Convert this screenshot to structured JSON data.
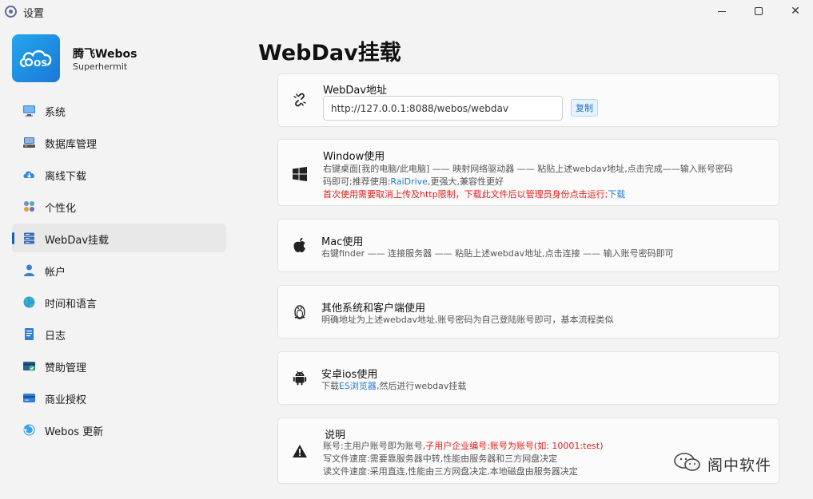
{
  "window": {
    "title": "设置",
    "minimize_glyph": "",
    "maximize_glyph": "",
    "close_glyph": "✕"
  },
  "profile": {
    "name": "腾飞Webos",
    "subtitle": "Superhermit",
    "logo_text": "OS"
  },
  "sidebar": {
    "items": [
      {
        "label": "系统",
        "icon": "monitor-icon"
      },
      {
        "label": "数据库管理",
        "icon": "database-icon"
      },
      {
        "label": "离线下载",
        "icon": "cloud-download-icon"
      },
      {
        "label": "个性化",
        "icon": "personalize-icon"
      },
      {
        "label": "WebDav挂载",
        "icon": "server-icon",
        "active": true
      },
      {
        "label": "帐户",
        "icon": "account-icon"
      },
      {
        "label": "时间和语言",
        "icon": "globe-icon"
      },
      {
        "label": "日志",
        "icon": "log-icon"
      },
      {
        "label": "赞助管理",
        "icon": "sponsor-icon"
      },
      {
        "label": "商业授权",
        "icon": "card-icon"
      },
      {
        "label": "Webos 更新",
        "icon": "update-icon"
      }
    ]
  },
  "main": {
    "title": "WebDav挂载",
    "address": {
      "label": "WebDav地址",
      "value": "http://127.0.0.1:8088/webos/webdav",
      "copy_label": "复制"
    },
    "windows": {
      "title": "Window使用",
      "line1": "右键桌面[我的电脑/此电脑] —— 映射网络驱动器 —— 粘贴上述webdav地址,点击完成——输入账号密码",
      "line2_pre": "码即可;推荐使用:",
      "line2_link": "RaiDrive",
      "line2_post": ",更强大,兼容性更好",
      "line3_red": "首次使用需要取消上传及http限制，下载此文件后以管理员身份点击运行;",
      "line3_link": "下载"
    },
    "mac": {
      "title": "Mac使用",
      "text": "右键finder —— 连接服务器 —— 粘贴上述webdav地址,点击连接 —— 输入账号密码即可"
    },
    "other": {
      "title": "其他系统和客户端使用",
      "text": "明确地址为上述webdav地址,账号密码为自己登陆账号即可，基本流程类似"
    },
    "android": {
      "title": "安卓ios使用",
      "text_pre": "下载",
      "text_link": "ES浏览器",
      "text_post": ",然后进行webdav挂载"
    },
    "notes": {
      "title": "说明",
      "line1_pre": "账号:主用户账号即为账号,",
      "line1_red": "子用户企业编号:账号为账号(如: 10001:test)",
      "line2": "写文件速度:需要靠服务器中转,性能由服务器和三方网盘决定",
      "line3": "读文件速度:采用直连,性能由三方网盘决定,本地磁盘由服务器决定"
    }
  },
  "watermark": {
    "text": "阁中软件"
  },
  "colors": {
    "accent": "#1c5fb8",
    "link": "#1e7bd3",
    "warning_red": "#e51a1a"
  }
}
